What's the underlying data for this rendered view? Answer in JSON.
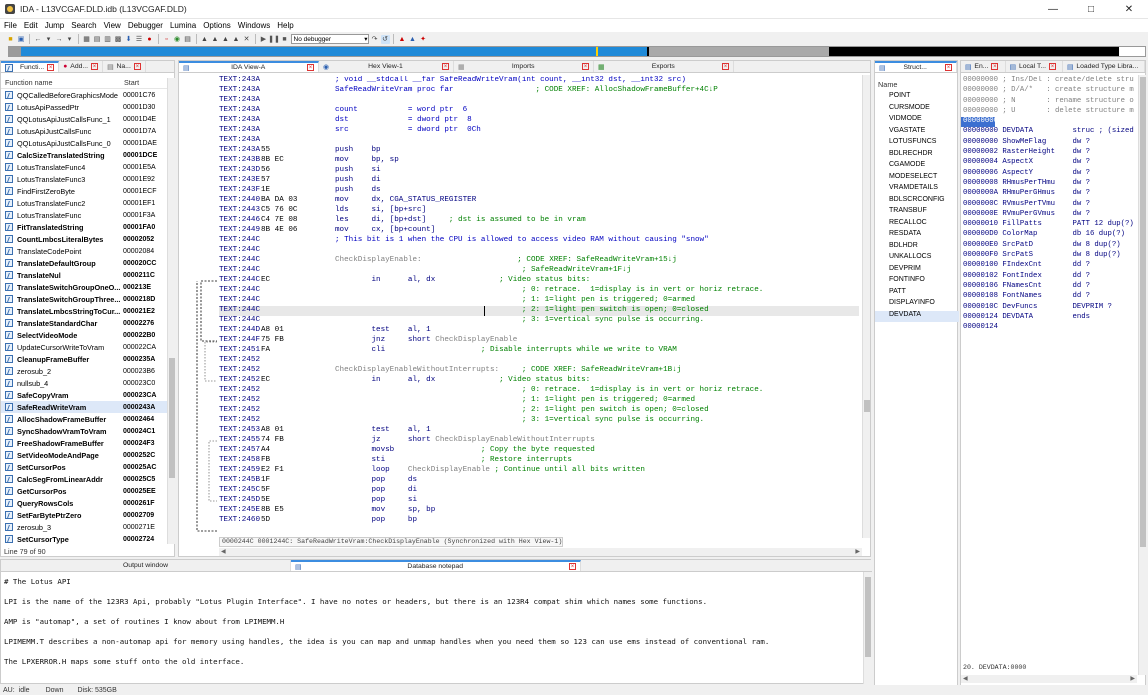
{
  "window": {
    "title": "IDA - L13VCGAF.DLD.idb (L13VCGAF.DLD)",
    "controls": [
      "—",
      "□",
      "✕"
    ]
  },
  "menu": [
    "File",
    "Edit",
    "Jump",
    "Search",
    "View",
    "Debugger",
    "Lumina",
    "Options",
    "Windows",
    "Help"
  ],
  "toolbar": {
    "debugger_select": "No debugger"
  },
  "functions": {
    "tabs": [
      {
        "label": "Functi..."
      },
      {
        "label": "Add..."
      },
      {
        "label": "Na..."
      }
    ],
    "header": {
      "name": "Function name",
      "start": "Start"
    },
    "rows": [
      {
        "name": "QQCalledBeforeGraphicsMode",
        "start": "00001C76",
        "bold": false
      },
      {
        "name": "LotusApiPassedPtr",
        "start": "00001D30",
        "bold": false
      },
      {
        "name": "QQLotusApiJustCallsFunc_1",
        "start": "00001D4E",
        "bold": false
      },
      {
        "name": "LotusApiJustCallsFunc",
        "start": "00001D7A",
        "bold": false
      },
      {
        "name": "QQLotusApiJustCallsFunc_0",
        "start": "00001DAE",
        "bold": false
      },
      {
        "name": "CalcSizeTranslatedString",
        "start": "00001DCE",
        "bold": true
      },
      {
        "name": "LotusTranslateFunc4",
        "start": "00001E5A",
        "bold": false
      },
      {
        "name": "LotusTranslateFunc3",
        "start": "00001E92",
        "bold": false
      },
      {
        "name": "FindFirstZeroByte",
        "start": "00001ECF",
        "bold": false
      },
      {
        "name": "LotusTranslateFunc2",
        "start": "00001EF1",
        "bold": false
      },
      {
        "name": "LotusTranslateFunc",
        "start": "00001F3A",
        "bold": false
      },
      {
        "name": "FitTranslatedString",
        "start": "00001FA0",
        "bold": true
      },
      {
        "name": "CountLmbcsLiteralBytes",
        "start": "00002052",
        "bold": true
      },
      {
        "name": "TranslateCodePoint",
        "start": "00002084",
        "bold": false
      },
      {
        "name": "TranslateDefaultGroup",
        "start": "000020CC",
        "bold": true
      },
      {
        "name": "TranslateNul",
        "start": "0000211C",
        "bold": true
      },
      {
        "name": "TranslateSwitchGroupOneO...",
        "start": "000213E",
        "bold": true
      },
      {
        "name": "TranslateSwitchGroupThree...",
        "start": "0000218D",
        "bold": true
      },
      {
        "name": "TranslateLmbcsStringToCur...",
        "start": "000021E2",
        "bold": true
      },
      {
        "name": "TranslateStandardChar",
        "start": "00002276",
        "bold": true
      },
      {
        "name": "SelectVideoMode",
        "start": "000022B0",
        "bold": true
      },
      {
        "name": "UpdateCursorWriteToVram",
        "start": "000022CA",
        "bold": false
      },
      {
        "name": "CleanupFrameBuffer",
        "start": "0000235A",
        "bold": true
      },
      {
        "name": "zerosub_2",
        "start": "000023B6",
        "bold": false
      },
      {
        "name": "nullsub_4",
        "start": "000023C0",
        "bold": false
      },
      {
        "name": "SafeCopyVram",
        "start": "000023CA",
        "bold": true
      },
      {
        "name": "SafeReadWriteVram",
        "start": "0000243A",
        "bold": true
      },
      {
        "name": "AllocShadowFrameBuffer",
        "start": "00002464",
        "bold": true
      },
      {
        "name": "SyncShadowVramToVram",
        "start": "000024C1",
        "bold": true
      },
      {
        "name": "FreeShadowFrameBuffer",
        "start": "000024F3",
        "bold": true
      },
      {
        "name": "SetVideoModeAndPage",
        "start": "0000252C",
        "bold": true
      },
      {
        "name": "SetCursorPos",
        "start": "000025AC",
        "bold": true
      },
      {
        "name": "CalcSegFromLinearAddr",
        "start": "000025C5",
        "bold": true
      },
      {
        "name": "GetCursorPos",
        "start": "000025EE",
        "bold": true
      },
      {
        "name": "QueryRowsCols",
        "start": "0000261F",
        "bold": true
      },
      {
        "name": "SetFarBytePtrZero",
        "start": "00002709",
        "bold": true
      },
      {
        "name": "zerosub_3",
        "start": "0000271E",
        "bold": false
      },
      {
        "name": "SetCursorType",
        "start": "00002724",
        "bold": true
      }
    ],
    "status": "Line 79 of 90"
  },
  "tabs_center": [
    {
      "label": "IDA View-A"
    },
    {
      "label": "Hex View-1"
    },
    {
      "label": "Imports"
    },
    {
      "label": "Exports"
    }
  ],
  "ida_view": {
    "lines": [
      {
        "addr": "TEXT:243A",
        "dot": "",
        "bytes": "",
        "c": [
          [
            "; void __stdcall __far SafeReadWriteVram(int count, __int32 dst, __int32 src)",
            "blu"
          ]
        ]
      },
      {
        "addr": "TEXT:243A",
        "dot": "",
        "bytes": "",
        "c": [
          [
            "SafeReadWriteVram proc far",
            "blu"
          ],
          [
            "                  ; CODE XREF: AllocShadowFrameBuffer+4C↓P",
            "grn"
          ]
        ]
      },
      {
        "addr": "TEXT:243A",
        "dot": "",
        "bytes": "",
        "c": []
      },
      {
        "addr": "TEXT:243A",
        "dot": "",
        "bytes": "",
        "c": [
          [
            "count           = word ptr  6",
            "blu"
          ]
        ]
      },
      {
        "addr": "TEXT:243A",
        "dot": "",
        "bytes": "",
        "c": [
          [
            "dst             = dword ptr  8",
            "blu"
          ]
        ]
      },
      {
        "addr": "TEXT:243A",
        "dot": "",
        "bytes": "",
        "c": [
          [
            "src             = dword ptr  0Ch",
            "blu"
          ]
        ]
      },
      {
        "addr": "TEXT:243A",
        "dot": "",
        "bytes": "",
        "c": []
      },
      {
        "addr": "TEXT:243A",
        "dot": "*",
        "bytes": "55",
        "c": [
          [
            "push    bp",
            "mnem"
          ]
        ]
      },
      {
        "addr": "TEXT:243B",
        "dot": "*",
        "bytes": "8B EC",
        "c": [
          [
            "mov     bp, sp",
            "mnem"
          ]
        ]
      },
      {
        "addr": "TEXT:243D",
        "dot": "*",
        "bytes": "56",
        "c": [
          [
            "push    si",
            "mnem"
          ]
        ]
      },
      {
        "addr": "TEXT:243E",
        "dot": "*",
        "bytes": "57",
        "c": [
          [
            "push    di",
            "mnem"
          ]
        ]
      },
      {
        "addr": "TEXT:243F",
        "dot": "*",
        "bytes": "1E",
        "c": [
          [
            "push    ds",
            "mnem"
          ]
        ]
      },
      {
        "addr": "TEXT:2440",
        "dot": "*",
        "bytes": "BA DA 03",
        "c": [
          [
            "mov     dx, CGA_STATUS_REGISTER",
            "mnem"
          ]
        ]
      },
      {
        "addr": "TEXT:2443",
        "dot": "*",
        "bytes": "C5 76 0C",
        "c": [
          [
            "lds     si, [bp+src]",
            "mnem"
          ]
        ]
      },
      {
        "addr": "TEXT:2446",
        "dot": "*",
        "bytes": "C4 7E 08",
        "c": [
          [
            "les     di, [bp+dst]",
            "mnem"
          ],
          [
            "     ; dst is assumed to be in vram",
            "grn"
          ]
        ]
      },
      {
        "addr": "TEXT:2449",
        "dot": "*",
        "bytes": "8B 4E 06",
        "c": [
          [
            "mov     cx, [bp+count]",
            "mnem"
          ]
        ]
      },
      {
        "addr": "TEXT:244C",
        "dot": "",
        "bytes": "",
        "c": [
          [
            "; This bit is 1 when the CPU is allowed to access video RAM without causing \"snow\"",
            "blu"
          ]
        ]
      },
      {
        "addr": "TEXT:244C",
        "dot": "",
        "bytes": "",
        "c": []
      },
      {
        "addr": "TEXT:244C",
        "dot": "",
        "bytes": "",
        "c": [
          [
            "CheckDisplayEnable:",
            "gry"
          ],
          [
            "                     ; CODE XREF: SafeReadWriteVram+15↓j",
            "grn"
          ]
        ]
      },
      {
        "addr": "TEXT:244C",
        "dot": "",
        "bytes": "",
        "c": [
          [
            "                                         ; SafeReadWriteVram+1F↓j",
            "grn"
          ]
        ]
      },
      {
        "addr": "TEXT:244C",
        "dot": "",
        "bytes": "EC",
        "c": [
          [
            "        in      al, dx",
            "mnem"
          ],
          [
            "              ; Video status bits:",
            "grn"
          ]
        ]
      },
      {
        "addr": "TEXT:244C",
        "dot": "",
        "bytes": "",
        "c": [
          [
            "                                         ; 0: retrace.  1=display is in vert or horiz retrace.",
            "grn"
          ]
        ]
      },
      {
        "addr": "TEXT:244C",
        "dot": "",
        "bytes": "",
        "c": [
          [
            "                                         ; 1: 1=light pen is triggered; 0=armed",
            "grn"
          ]
        ]
      },
      {
        "addr": "TEXT:244C",
        "dot": "",
        "bytes": "",
        "c": [
          [
            "                                         ; 2: 1=light pen switch is open; 0=closed",
            "grn"
          ]
        ],
        "hl": true
      },
      {
        "addr": "TEXT:244C",
        "dot": "",
        "bytes": "",
        "c": [
          [
            "                                         ; 3: 1=vertical sync pulse is occurring.",
            "grn"
          ]
        ]
      },
      {
        "addr": "TEXT:244D",
        "dot": "*",
        "bytes": "A8 01",
        "c": [
          [
            "        test    al, 1",
            "mnem"
          ]
        ]
      },
      {
        "addr": "TEXT:244F",
        "dot": "*",
        "bytes": "75 FB",
        "c": [
          [
            "        jnz     short ",
            "mnem"
          ],
          [
            "CheckDisplayEnable",
            "gry"
          ]
        ]
      },
      {
        "addr": "TEXT:2451",
        "dot": "*",
        "bytes": "FA",
        "c": [
          [
            "        cli",
            "mnem"
          ],
          [
            "                     ; Disable interrupts while we write to VRAM",
            "grn"
          ]
        ]
      },
      {
        "addr": "TEXT:2452",
        "dot": "",
        "bytes": "",
        "c": []
      },
      {
        "addr": "TEXT:2452",
        "dot": "",
        "bytes": "",
        "c": [
          [
            "CheckDisplayEnableWithoutInterrupts:",
            "gry"
          ],
          [
            "     ; CODE XREF: SafeReadWriteVram+1B↓j",
            "grn"
          ]
        ]
      },
      {
        "addr": "TEXT:2452",
        "dot": "",
        "bytes": "EC",
        "c": [
          [
            "        in      al, dx",
            "mnem"
          ],
          [
            "              ; Video status bits:",
            "grn"
          ]
        ]
      },
      {
        "addr": "TEXT:2452",
        "dot": "",
        "bytes": "",
        "c": [
          [
            "                                         ; 0: retrace.  1=display is in vert or horiz retrace.",
            "grn"
          ]
        ]
      },
      {
        "addr": "TEXT:2452",
        "dot": "",
        "bytes": "",
        "c": [
          [
            "                                         ; 1: 1=light pen is triggered; 0=armed",
            "grn"
          ]
        ]
      },
      {
        "addr": "TEXT:2452",
        "dot": "",
        "bytes": "",
        "c": [
          [
            "                                         ; 2: 1=light pen switch is open; 0=closed",
            "grn"
          ]
        ]
      },
      {
        "addr": "TEXT:2452",
        "dot": "",
        "bytes": "",
        "c": [
          [
            "                                         ; 3: 1=vertical sync pulse is occurring.",
            "grn"
          ]
        ]
      },
      {
        "addr": "TEXT:2453",
        "dot": "*",
        "bytes": "A8 01",
        "c": [
          [
            "        test    al, 1",
            "mnem"
          ]
        ]
      },
      {
        "addr": "TEXT:2455",
        "dot": "*",
        "bytes": "74 FB",
        "c": [
          [
            "        jz      short ",
            "mnem"
          ],
          [
            "CheckDisplayEnableWithoutInterrupts",
            "gry"
          ]
        ]
      },
      {
        "addr": "TEXT:2457",
        "dot": "*",
        "bytes": "A4",
        "c": [
          [
            "        movsb",
            "mnem"
          ],
          [
            "                   ; Copy the byte requested",
            "grn"
          ]
        ]
      },
      {
        "addr": "TEXT:2458",
        "dot": "*",
        "bytes": "FB",
        "c": [
          [
            "        sti",
            "mnem"
          ],
          [
            "                     ; Restore interrupts",
            "grn"
          ]
        ]
      },
      {
        "addr": "TEXT:2459",
        "dot": "*",
        "bytes": "E2 F1",
        "c": [
          [
            "        loop    ",
            "mnem"
          ],
          [
            "CheckDisplayEnable",
            "gry"
          ],
          [
            " ; Continue until all bits written",
            "grn"
          ]
        ]
      },
      {
        "addr": "TEXT:245B",
        "dot": "*",
        "bytes": "1F",
        "c": [
          [
            "        pop     ds",
            "mnem"
          ]
        ]
      },
      {
        "addr": "TEXT:245C",
        "dot": "*",
        "bytes": "5F",
        "c": [
          [
            "        pop     di",
            "mnem"
          ]
        ]
      },
      {
        "addr": "TEXT:245D",
        "dot": "*",
        "bytes": "5E",
        "c": [
          [
            "        pop     si",
            "mnem"
          ]
        ]
      },
      {
        "addr": "TEXT:245E",
        "dot": "*",
        "bytes": "8B E5",
        "c": [
          [
            "        mov     sp, bp",
            "mnem"
          ]
        ]
      },
      {
        "addr": "TEXT:2460",
        "dot": "*",
        "bytes": "5D",
        "c": [
          [
            "        pop     bp",
            "mnem"
          ]
        ]
      }
    ],
    "statusline": "0000244C 0001244C: SafeReadWriteVram:CheckDisplayEnable (Synchronized with Hex View-1)"
  },
  "structures": {
    "tab": "Struct...",
    "header": "Name",
    "items": [
      "POINT",
      "CURSMODE",
      "VIDMODE",
      "VGASTATE",
      "LOTUSFUNCS",
      "BDLRECHDR",
      "CGAMODE",
      "MODESELECT",
      "VRAMDETAILS",
      "BDLSCRCONFIG",
      "TRANSBUF",
      "RECALLOC",
      "RESDATA",
      "BDLHDR",
      "UNKALLOCS",
      "DEVPRIM",
      "FONTINFO",
      "PATT",
      "DISPLAYINFO",
      "DEVDATA"
    ],
    "selected": "DEVDATA"
  },
  "right_tabs": [
    {
      "label": "En..."
    },
    {
      "label": "Local T..."
    },
    {
      "label": "Loaded Type Libra..."
    }
  ],
  "struct_view": {
    "lines": [
      [
        "00000000 ; Ins/Del : create/delete stru",
        "grn"
      ],
      [
        "00000000 ; D/A/*   : create structure m",
        "grn"
      ],
      [
        "00000000 ; N       : rename structure o",
        "grn"
      ],
      [
        "00000000 ; U       : delete structure m",
        "grn"
      ],
      [
        "00000000",
        "sel"
      ],
      [
        "00000000 DEVDATA         struc ; (sized",
        "blu"
      ],
      [
        "00000000 ShowMeFlag      dw ?",
        "blu"
      ],
      [
        "00000002 RasterHeight    dw ?",
        "blu"
      ],
      [
        "00000004 AspectX         dw ?",
        "blu"
      ],
      [
        "00000006 AspectY         dw ?",
        "blu"
      ],
      [
        "00000008 RHmusPerTHmu    dw ?",
        "blu"
      ],
      [
        "0000000A RHmuPerGHmus    dw ?",
        "blu"
      ],
      [
        "0000000C RVmusPerTVmu    dw ?",
        "blu"
      ],
      [
        "0000000E RVmuPerGVmus    dw ?",
        "blu"
      ],
      [
        "00000010 FillPatts       PATT 12 dup(?)",
        "blu"
      ],
      [
        "000000D0 ColorMap        db 16 dup(?)",
        "blu"
      ],
      [
        "000000E0 SrcPatD         dw 8 dup(?)",
        "blu"
      ],
      [
        "000000F0 SrcPatS         dw 8 dup(?)",
        "blu"
      ],
      [
        "00000100 FIndexCnt       dd ?",
        "blu"
      ],
      [
        "00000102 FontIndex       dd ?",
        "blu"
      ],
      [
        "00000106 FNamesCnt       dd ?",
        "blu"
      ],
      [
        "00000108 FontNames       dd ?",
        "blu"
      ],
      [
        "0000010C DevFuncs        DEVPRIM ?",
        "blu"
      ],
      [
        "00000124 DEVDATA         ends",
        "blu"
      ],
      [
        "00000124",
        "blu"
      ]
    ],
    "status": "20. DEVDATA:0000"
  },
  "bottom": {
    "output_tab": "Output window",
    "notepad_tab": "Database notepad",
    "notepad_lines": [
      "# The Lotus API",
      "",
      "LPI is the name of the 123R3 Api, probably \"Lotus Plugin Interface\". I have no notes or headers, but there is an 123R4 compat shim which names some functions.",
      "",
      "AMP is \"automap\", a set of routines I know about from LPIMEMM.H",
      "",
      "LPIMEMM.T describes a non-automap api for memory using handles, the idea is you can map and unmap handles when you need them so 123 can use ems instead of conventional ram.",
      "",
      "The LPXERROR.H maps some stuff onto the old interface."
    ]
  },
  "statusbar": {
    "au": "AU:",
    "state": "idle",
    "dir": "Down",
    "disk": "Disk: 535GB"
  },
  "colors": {
    "accent": "#3c8de0",
    "nav_blue": "#1f8ad8",
    "nav_black": "#000000",
    "nav_gray": "#a9a9a9",
    "selection": "#dde8f8"
  }
}
